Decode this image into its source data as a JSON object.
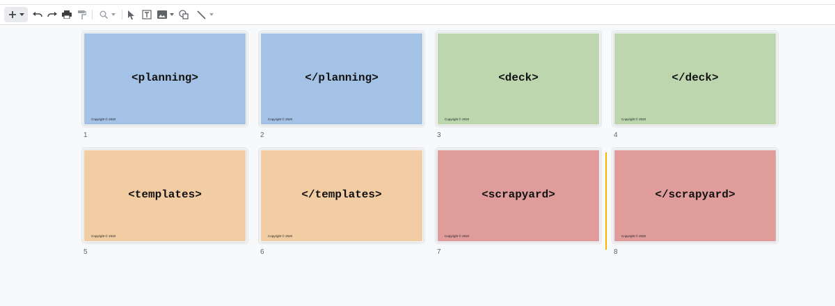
{
  "toolbar": {
    "icons": [
      "add-icon",
      "chevron-down-icon",
      "undo-icon",
      "redo-icon",
      "print-icon",
      "paint-format-icon",
      "zoom-icon",
      "chevron-down-icon",
      "select-icon",
      "text-box-icon",
      "image-icon",
      "chevron-down-icon",
      "shape-icon",
      "line-icon",
      "chevron-down-icon"
    ]
  },
  "slides": [
    {
      "number": "1",
      "title": "<planning>",
      "footer": "Copyright © 2020",
      "color": "#a4c2e6"
    },
    {
      "number": "2",
      "title": "</planning>",
      "footer": "Copyright © 2020",
      "color": "#a4c2e6"
    },
    {
      "number": "3",
      "title": "<deck>",
      "footer": "Copyright © 2020",
      "color": "#bdd6ad"
    },
    {
      "number": "4",
      "title": "</deck>",
      "footer": "Copyright © 2020",
      "color": "#bdd6ad"
    },
    {
      "number": "5",
      "title": "<templates>",
      "footer": "Copyright © 2020",
      "color": "#f2cca2"
    },
    {
      "number": "6",
      "title": "</templates>",
      "footer": "Copyright © 2020",
      "color": "#f2cca2"
    },
    {
      "number": "7",
      "title": "<scrapyard>",
      "footer": "Copyright © 2020",
      "color": "#df9c9a"
    },
    {
      "number": "8",
      "title": "</scrapyard>",
      "footer": "Copyright © 2020",
      "color": "#df9c9a"
    }
  ],
  "colors": {
    "drop_marker": "#f4b400"
  }
}
